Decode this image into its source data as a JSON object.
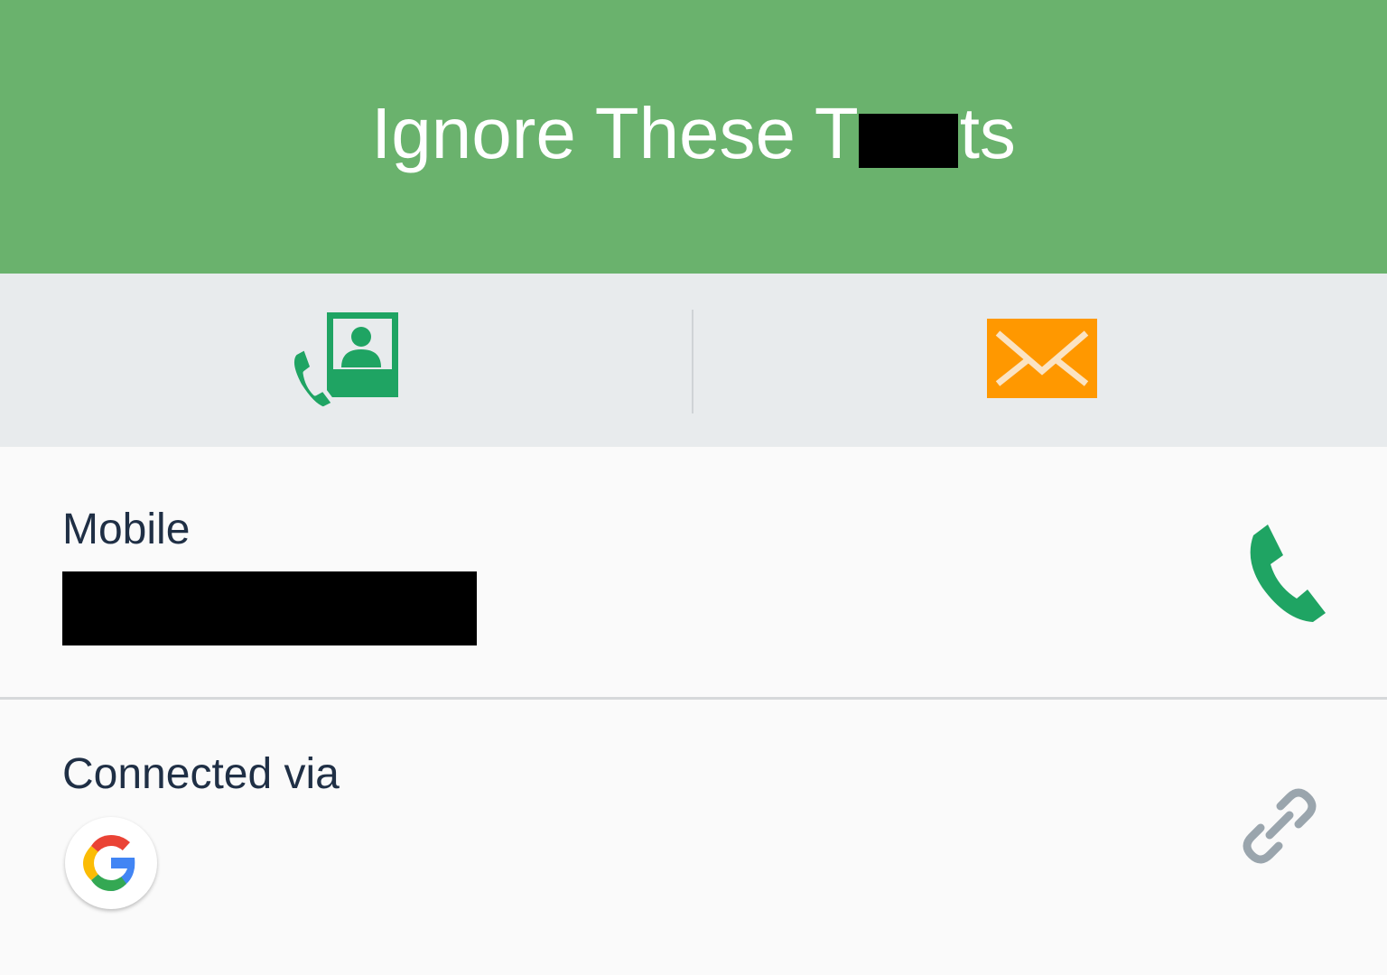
{
  "header": {
    "title_start": "Ignore These T",
    "title_end": "ts",
    "background": "#6ab26d",
    "text_color": "#ffffff"
  },
  "actions": [
    {
      "icon": "contact-call-icon",
      "color": "#1fa463"
    },
    {
      "icon": "envelope-icon",
      "color": "#ff9800"
    }
  ],
  "details": {
    "mobile": {
      "label": "Mobile",
      "action_icon": "phone-icon",
      "action_color": "#1fa463"
    },
    "connected": {
      "label": "Connected via",
      "account_icon": "google-icon",
      "action_icon": "link-icon",
      "action_color": "#9aa5ad"
    }
  },
  "colors": {
    "text": "#1f2f45",
    "action_bar": "#e8ebed",
    "row_background": "#fafafa"
  }
}
